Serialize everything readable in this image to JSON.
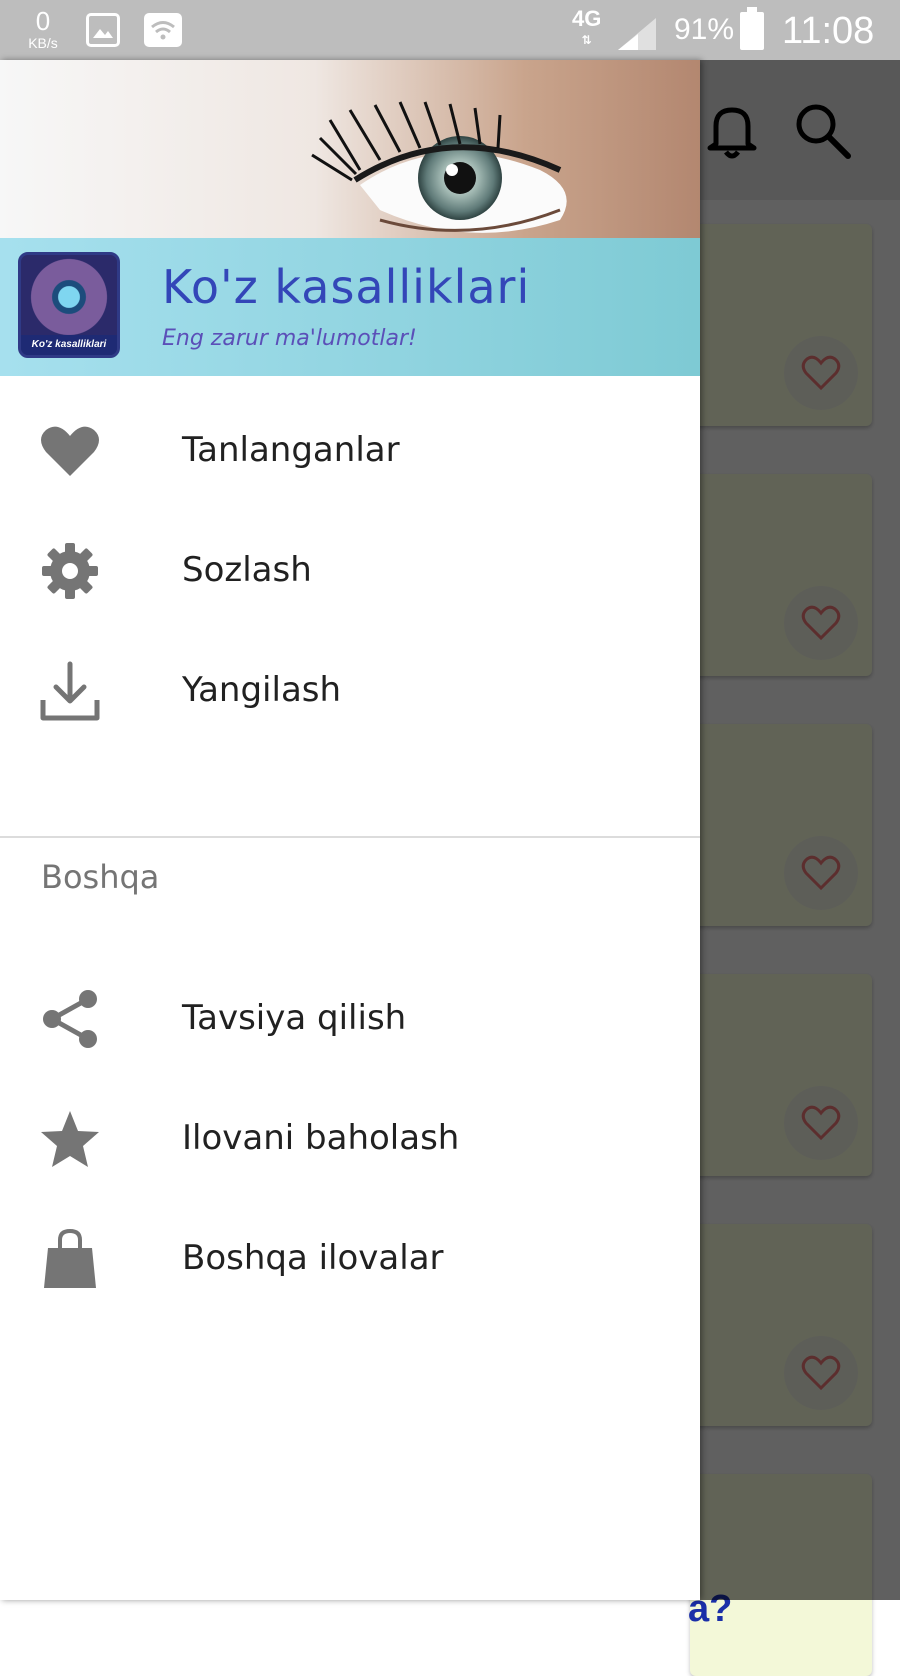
{
  "status_bar": {
    "speed_value": "0",
    "speed_unit": "KB/s",
    "network": "4G",
    "battery_percent": "91%",
    "time": "11:08",
    "icons": [
      "gallery-icon",
      "wifi-icon",
      "signal-icon",
      "battery-icon"
    ]
  },
  "drawer": {
    "header": {
      "title": "Ko'z kasalliklari",
      "subtitle": "Eng zarur ma'lumotlar!",
      "logo_caption": "Ko'z kasalliklari"
    },
    "items": [
      {
        "label": "Tanlanganlar",
        "icon": "heart-icon"
      },
      {
        "label": "Sozlash",
        "icon": "gear-icon"
      },
      {
        "label": "Yangilash",
        "icon": "download-icon"
      }
    ],
    "section_title": "Boshqa",
    "other_items": [
      {
        "label": "Tavsiya qilish",
        "icon": "share-icon"
      },
      {
        "label": "Ilovani baholash",
        "icon": "star-icon"
      },
      {
        "label": "Boshqa ilovalar",
        "icon": "shopping-bag-icon"
      }
    ]
  },
  "background_app": {
    "toolbar_icons": [
      "bell-icon",
      "search-icon"
    ],
    "bottom_text": "a?"
  },
  "colors": {
    "title_blue": "#3346b8",
    "header_band": "#8fd3df",
    "icon_gray": "#757575",
    "favorite_red": "#e57373"
  }
}
